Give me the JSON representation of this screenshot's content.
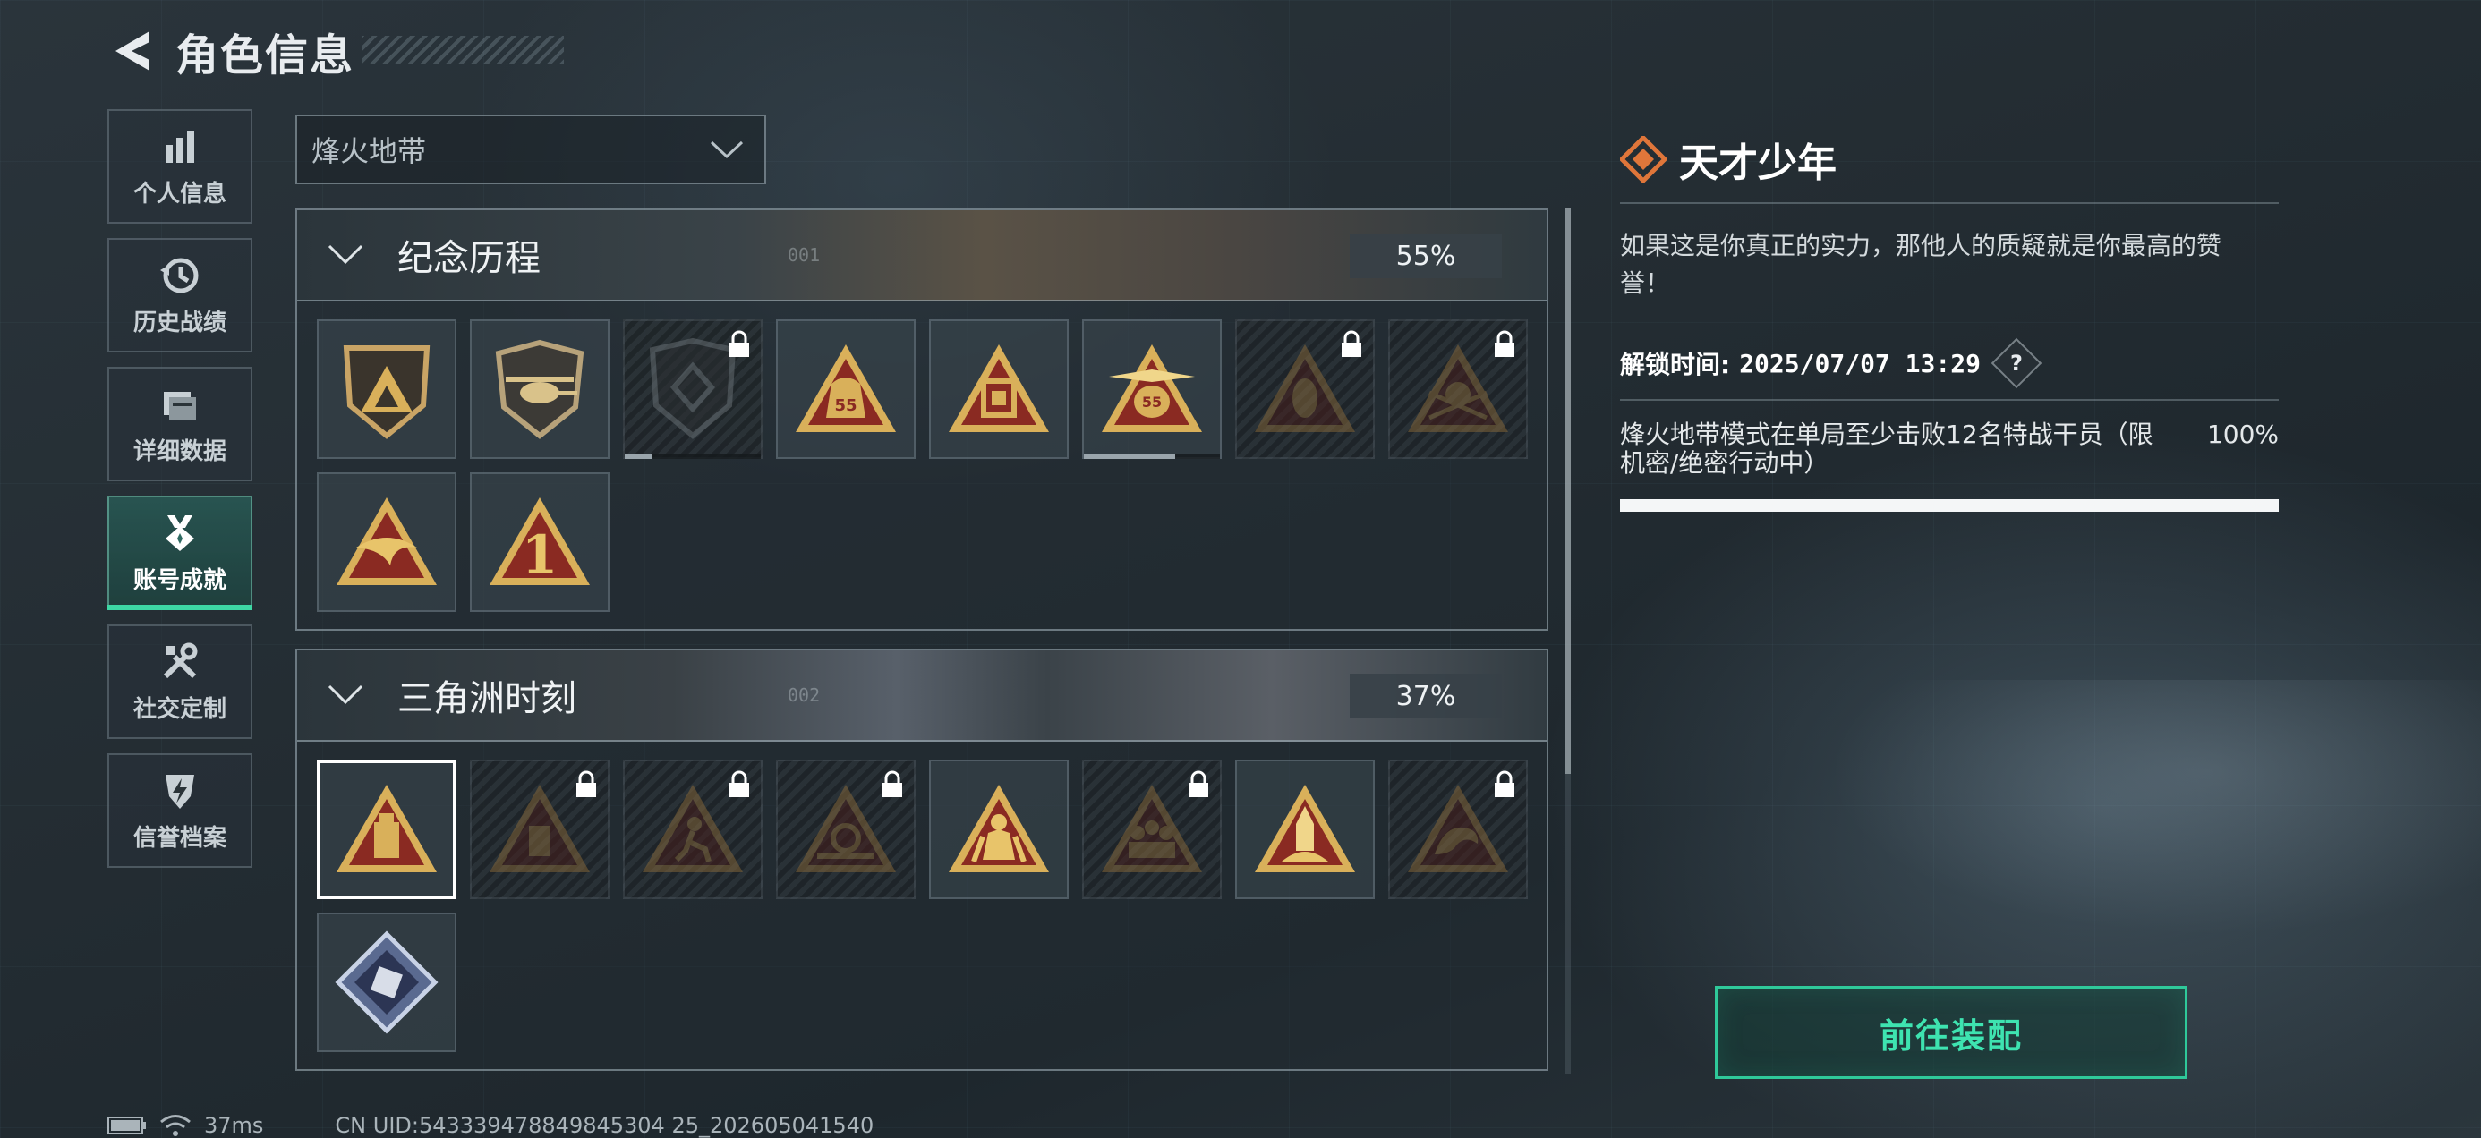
{
  "header": {
    "title": "角色信息"
  },
  "sidebar": {
    "items": [
      {
        "label": "个人信息",
        "icon": "bar-chart-icon"
      },
      {
        "label": "历史战绩",
        "icon": "history-clock-icon"
      },
      {
        "label": "详细数据",
        "icon": "folder-icon"
      },
      {
        "label": "账号成就",
        "icon": "medal-icon",
        "active": true
      },
      {
        "label": "社交定制",
        "icon": "tools-icon"
      },
      {
        "label": "信誉档案",
        "icon": "shield-bolt-icon"
      }
    ]
  },
  "mode_select": {
    "value": "烽火地带"
  },
  "sections": [
    {
      "title": "纪念历程",
      "code": "001",
      "percent": "55%",
      "badges": [
        {
          "name": "badge-mountain",
          "locked": false
        },
        {
          "name": "badge-helicopter",
          "locked": false
        },
        {
          "name": "badge-diamond-shield",
          "locked": true,
          "progress": 0.2
        },
        {
          "name": "badge-bag-55",
          "locked": false
        },
        {
          "name": "badge-box",
          "locked": false
        },
        {
          "name": "badge-winged-55",
          "locked": false,
          "progress": 0.67
        },
        {
          "name": "badge-mask",
          "locked": true
        },
        {
          "name": "badge-soldier",
          "locked": true
        },
        {
          "name": "badge-wave",
          "locked": false
        },
        {
          "name": "badge-number-one",
          "locked": false
        }
      ]
    },
    {
      "title": "三角洲时刻",
      "code": "002",
      "percent": "37%",
      "badges": [
        {
          "name": "badge-usb",
          "locked": false,
          "selected": true
        },
        {
          "name": "badge-drive",
          "locked": true
        },
        {
          "name": "badge-runner",
          "locked": true
        },
        {
          "name": "badge-hand-gear",
          "locked": true
        },
        {
          "name": "badge-squad",
          "locked": false
        },
        {
          "name": "badge-team",
          "locked": true
        },
        {
          "name": "badge-rocket",
          "locked": false
        },
        {
          "name": "badge-dragon",
          "locked": true
        },
        {
          "name": "badge-crystal",
          "locked": false
        }
      ]
    }
  ],
  "detail": {
    "title": "天才少年",
    "description": "如果这是你真正的实力，那他人的质疑就是你最高的赞誉！",
    "unlock_label": "解锁时间:",
    "unlock_time": "2025/07/07 13:29",
    "help": "?",
    "condition": "烽火地带模式在单局至少击败12名特战干员（限机密/绝密行动中）",
    "condition_percent": "100%",
    "condition_progress": 1.0
  },
  "equip_button": {
    "label": "前往装配"
  },
  "status_bar": {
    "ping": "37ms",
    "uid": "CN UID:543339478849845304 25_202605041540"
  },
  "colors": {
    "accent": "#3dd7a4",
    "button_text": "#3ee3b0",
    "icon_orange": "#e0763a",
    "badge_gold": "#d9b05a",
    "badge_red": "#8a2a22"
  }
}
